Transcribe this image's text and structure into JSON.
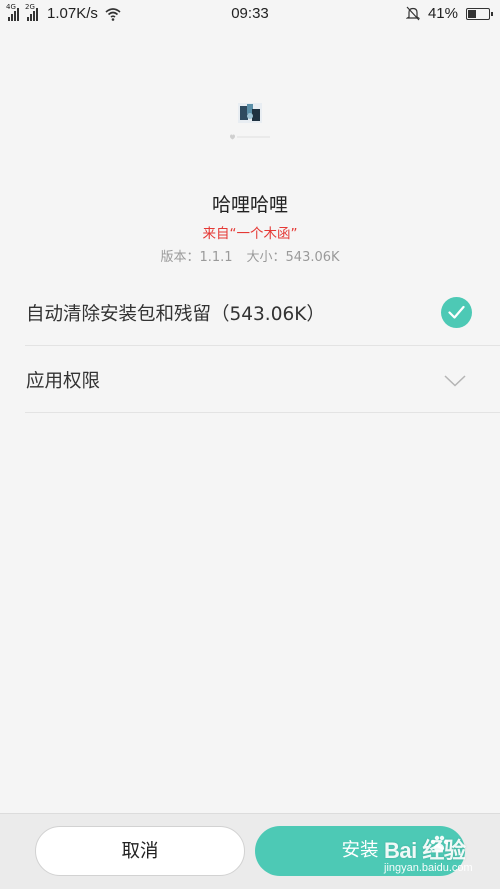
{
  "status_bar": {
    "network_1": "4G",
    "network_2": "2G",
    "speed": "1.07K/s",
    "time": "09:33",
    "battery": "41%",
    "battery_level": 0.41
  },
  "app": {
    "name": "哈哩哈哩",
    "source": "来自“一个木函”",
    "version": "版本：1.1.1",
    "size": "大小：543.06K"
  },
  "options": [
    {
      "label": "自动清除安装包和残留（543.06K）",
      "checked": true
    },
    {
      "label": "应用权限",
      "expandable": true
    }
  ],
  "buttons": {
    "cancel": "取消",
    "install": "安装"
  },
  "colors": {
    "accent": "#4dc9b5",
    "source_red": "#e53935"
  },
  "watermark": {
    "logo": "Bai  经验",
    "url": "jingyan.baidu.com"
  }
}
